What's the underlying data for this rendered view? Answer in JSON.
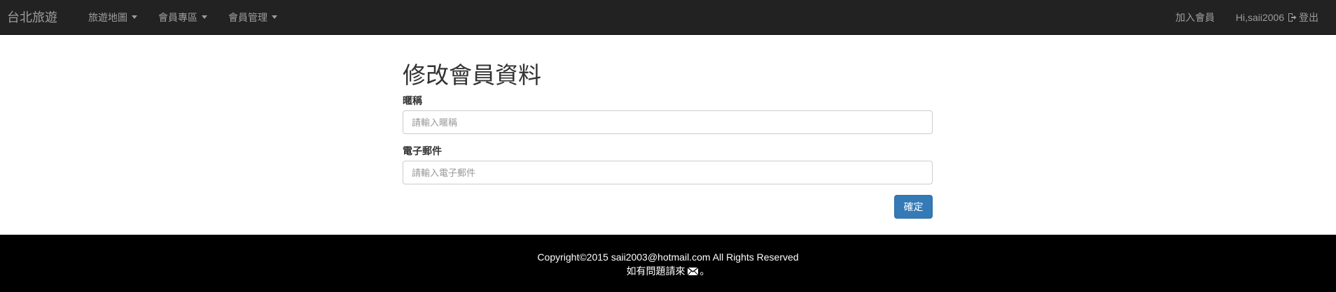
{
  "navbar": {
    "brand": "台北旅遊",
    "menus": [
      {
        "label": "旅遊地圖"
      },
      {
        "label": "會員專區"
      },
      {
        "label": "會員管理"
      }
    ],
    "join_label": "加入會員",
    "greeting": "Hi,saii2006",
    "logout_label": "登出"
  },
  "form": {
    "title": "修改會員資料",
    "nickname": {
      "label": "暱稱",
      "placeholder": "請輸入暱稱",
      "value": ""
    },
    "email": {
      "label": "電子郵件",
      "placeholder": "請輸入電子郵件",
      "value": ""
    },
    "submit_label": "確定"
  },
  "footer": {
    "copyright": "Copyright©2015 saii2003@hotmail.com All Rights Reserved",
    "contact_prefix": "如有問題請來",
    "contact_suffix": "。"
  },
  "colors": {
    "navbar_bg": "#222222",
    "nav_text": "#9d9d9d",
    "primary": "#337ab7",
    "footer_bg": "#000000"
  }
}
